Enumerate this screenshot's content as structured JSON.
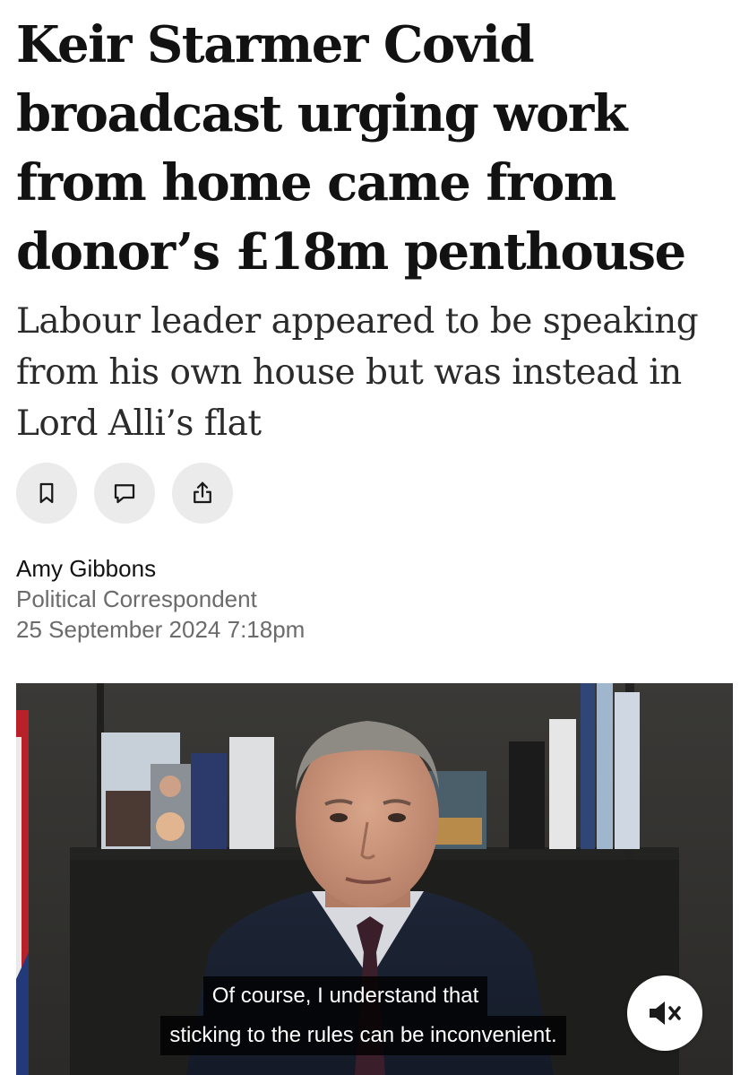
{
  "article": {
    "headline": "Keir Starmer Covid broadcast urging work from home came from donor’s £18m penthouse",
    "standfirst": "Labour leader appeared to be speaking from his own house but was instead in Lord Alli’s flat"
  },
  "actions": [
    {
      "icon": "bookmark-icon"
    },
    {
      "icon": "comment-icon"
    },
    {
      "icon": "share-icon"
    }
  ],
  "byline": {
    "author": "Amy Gibbons",
    "role": "Political Correspondent",
    "date": "25 September 2024 7:18pm"
  },
  "video": {
    "subtitle_line_1": "Of course, I understand that",
    "subtitle_line_2": "sticking to the rules can be inconvenient.",
    "mute_icon": "speaker-muted-icon"
  },
  "colors": {
    "text": "#121212",
    "secondary_text": "#6b6b6b",
    "button_bg": "#ebebeb"
  }
}
